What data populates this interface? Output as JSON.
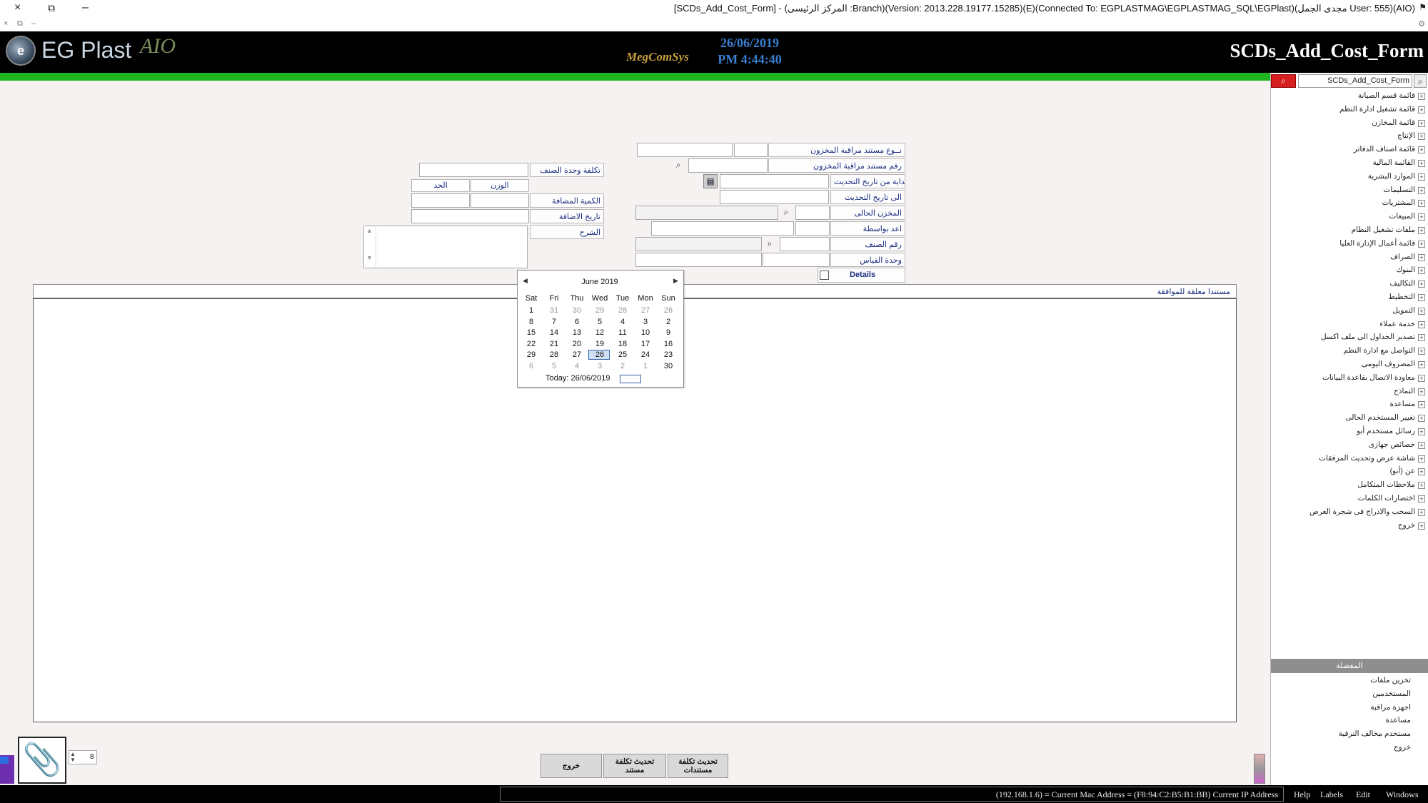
{
  "window": {
    "title": "[SCDs_Add_Cost_Form] - (المركز الرئيسى :Branch)(Version: 2013.228.19177.15285)(E)(Connected To: EGPLASTMAG\\EGPLASTMAG_SQL\\EGPlast)(مجدى الجمل User: 555)(AIO)",
    "close_icon": "×",
    "restore_icon": "⧉",
    "minimize_icon": "–",
    "sub_icons": [
      "×",
      "⧉",
      "–"
    ]
  },
  "header": {
    "logo_mark": "e",
    "logo_text": "EG Plast",
    "logo_aio": "AIO",
    "mcs_logo": "MegComSys",
    "date": "26/06/2019",
    "time": "PM 4:44:40",
    "form_name": "SCDs_Add_Cost_Form"
  },
  "tree": {
    "search_value": "SCDs_Add_Cost_Form",
    "items": [
      "قائمة قسم الصيانة",
      "قائمة تشغيل ادارة النظم",
      "قائمة المخازن",
      "الإنتاج",
      "قائمة اصناف الدفاتر",
      "القائمة المالية",
      "الموارد البشرية",
      "التسليمات",
      "المشتريات",
      "المبيعات",
      "ملفات تشغيل النظام",
      "قائمة أعمال الإدارة العليا",
      "الصراف",
      "البنوك",
      "التكاليف",
      "التخطيط",
      "التمويل",
      "خدمة عملاء",
      "تصدير الجداول الى ملف اكسل",
      "التواصل مع ادارة النظم",
      "المصروف اليومى",
      "معاودة الاتصال بقاعدة البيانات",
      "النماذج",
      "مساعدة",
      "تغيير المستخدم الحالى",
      "رسائل مستخدم أبو",
      "خصائص جهازى",
      "شاشة عرض وتحديث المرفقات",
      "عن (أبو)",
      "ملاحظات المتكامل",
      "اختصارات الكلمات",
      "السحب والادراج فى شجرة العرض",
      "خروج"
    ],
    "sub_header": "المفضلة",
    "sub_items": [
      "تخزين ملفات",
      "المستخدمين",
      "اجهزة مراقبة",
      "مساعدة",
      "مستخدم مخالف الترقية",
      "خروج"
    ]
  },
  "form": {
    "doc_type_label": "نــوع مستند مراقبة المخزون",
    "doc_no_label": "رقم مستند مراقبة المخزون",
    "from_date_label": "بداية من تاريخ التحديث",
    "to_date_label": "الى تاريخ التحديث",
    "current_store_label": "المخزن الحالى",
    "prepared_by_label": "اعد بواسطة",
    "item_no_label": "رقم الصنف",
    "unit_label": "وحدة القياس",
    "details_label": "Details",
    "unit_cost_label": "تكلفة وحدة الصنف",
    "weight_header": "الوزن",
    "limit_header": "الحد",
    "added_qty_label": "الكمية المضافة",
    "add_date_label": "تاريخ الاضافة",
    "description_label": "الشرح"
  },
  "calendar": {
    "month": "June 2019",
    "days": [
      "Sat",
      "Fri",
      "Thu",
      "Wed",
      "Tue",
      "Mon",
      "Sun"
    ],
    "rows": [
      [
        "1",
        "31",
        "30",
        "29",
        "28",
        "27",
        "26"
      ],
      [
        "8",
        "7",
        "6",
        "5",
        "4",
        "3",
        "2"
      ],
      [
        "15",
        "14",
        "13",
        "12",
        "11",
        "10",
        "9"
      ],
      [
        "22",
        "21",
        "20",
        "19",
        "18",
        "17",
        "16"
      ],
      [
        "29",
        "28",
        "27",
        "26",
        "25",
        "24",
        "23"
      ],
      [
        "6",
        "5",
        "4",
        "3",
        "2",
        "1",
        "30"
      ]
    ],
    "today_text": "Today: 26/06/2019"
  },
  "grid": {
    "title": "مستندا معلقة للموافقة"
  },
  "buttons": {
    "exit": "خروج",
    "update_doc_cost": "تحديث تكلفة مستند",
    "update_docs_cost": "تحديث تكلفة مستندات"
  },
  "attach": {
    "clip_icon": "📎",
    "count": "8",
    "spin_arrows": "▲ ▼"
  },
  "status": {
    "text": "(192.168.1.6) = Current Mac Address = (F8:94:C2:B5:B1:BB) Current IP Address",
    "menus": [
      "Help",
      "Labels",
      "Edit",
      "Windows"
    ]
  },
  "icons": {
    "search": "⌕",
    "calendar_button": "▦",
    "tree_expand": "+",
    "cal_prev": "◀",
    "cal_next": "▶"
  },
  "colors": {
    "header_bg": "#000000",
    "green_bar": "#1fb51f",
    "accent_blue": "#3a7fd0",
    "search_red": "#d62020",
    "label_text": "#1a2d80"
  }
}
